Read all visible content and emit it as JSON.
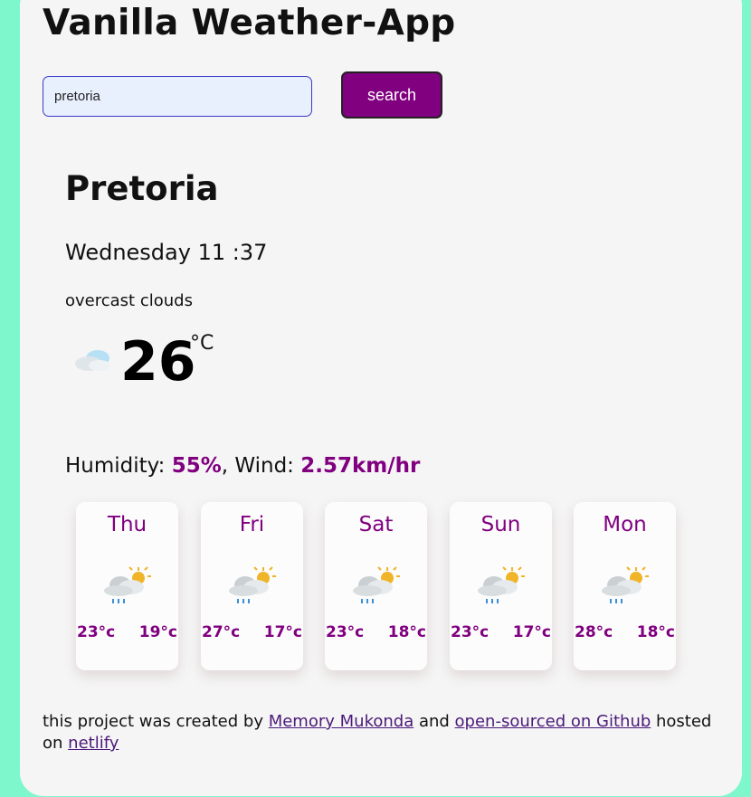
{
  "app": {
    "title": "Vanilla Weather-App"
  },
  "search": {
    "value": "pretoria",
    "button_label": "search"
  },
  "current": {
    "city": "Pretoria",
    "datetime": "Wednesday 11 :37",
    "description": "overcast clouds",
    "icon": "overcast-clouds-icon",
    "temperature": "26",
    "unit": "°C",
    "humidity_label": "Humidity: ",
    "humidity_value": "55%",
    "separator": ", ",
    "wind_label": "Wind: ",
    "wind_value": "2.57km/hr"
  },
  "forecast": [
    {
      "day": "Thu",
      "icon": "light-rain-sun-icon",
      "max": "23°c",
      "min": "19°c"
    },
    {
      "day": "Fri",
      "icon": "light-rain-sun-icon",
      "max": "27°c",
      "min": "17°c"
    },
    {
      "day": "Sat",
      "icon": "light-rain-sun-icon",
      "max": "23°c",
      "min": "18°c"
    },
    {
      "day": "Sun",
      "icon": "light-rain-sun-icon",
      "max": "23°c",
      "min": "17°c"
    },
    {
      "day": "Mon",
      "icon": "light-rain-sun-icon",
      "max": "28°c",
      "min": "18°c"
    }
  ],
  "footer": {
    "text1": "this project was created by ",
    "author_link": "Memory Mukonda",
    "text2": " and ",
    "github_link": "open-sourced on Github",
    "text3": " hosted on ",
    "netlify_link": "netlify"
  },
  "colors": {
    "accent": "#800080",
    "background": "#7ef7cc",
    "panel": "#f5f5f5"
  }
}
